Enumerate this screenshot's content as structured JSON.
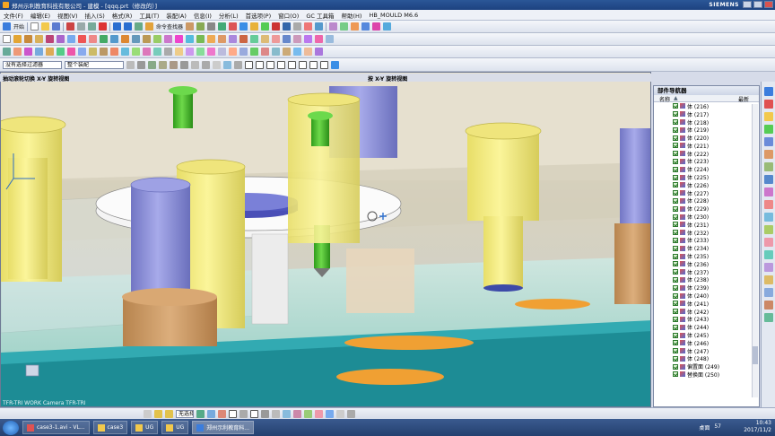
{
  "window": {
    "title": "郑州示利教育科技有限公司 - 建模 - [qqq.prt（修改的）]",
    "brand": "SIEMENS"
  },
  "menu": [
    "文件(F)",
    "编辑(E)",
    "视图(V)",
    "插入(S)",
    "格式(R)",
    "工具(T)",
    "装配(A)",
    "信息(I)",
    "分析(L)",
    "首选项(P)",
    "窗口(O)",
    "GC 工具箱",
    "帮助(H)",
    "HB_MOULD M6.6"
  ],
  "toolbar": {
    "start_label": "开始",
    "command_finder": "命令查找器",
    "filter_combo": "没有选择过滤器",
    "assembly_combo": "整个装配"
  },
  "viewport": {
    "left_label": "抽动滚轮切换 X-Y 旋转视图",
    "right_label": "按 X-Y 旋转视图",
    "wcs_label": "TFR-TRI WORK Camera TFR-TRI"
  },
  "navigator": {
    "title": "部件导航器",
    "col_name": "名称",
    "col_up": "最新",
    "items": [
      "体 (216)",
      "体 (217)",
      "体 (218)",
      "体 (219)",
      "体 (220)",
      "体 (221)",
      "体 (222)",
      "体 (223)",
      "体 (224)",
      "体 (225)",
      "体 (226)",
      "体 (227)",
      "体 (228)",
      "体 (229)",
      "体 (230)",
      "体 (231)",
      "体 (232)",
      "体 (233)",
      "体 (234)",
      "体 (235)",
      "体 (236)",
      "体 (237)",
      "体 (238)",
      "体 (239)",
      "体 (240)",
      "体 (241)",
      "体 (242)",
      "体 (243)",
      "体 (244)",
      "体 (245)",
      "体 (246)",
      "体 (247)",
      "体 (248)",
      "偏置面 (249)",
      "替换面 (250)"
    ]
  },
  "bottom_toolbar": {
    "label": "无选择过滤器"
  },
  "taskbar": {
    "buttons": [
      "case3-1.avi - VL...",
      "case3",
      "UG",
      "UG",
      "郑州示利教育科..."
    ],
    "tray_desktop": "桌面",
    "tray_num": "57",
    "time": "10:43",
    "date": "2017/11/2"
  },
  "colors": {
    "bottom_block": "#1d8c95",
    "plate": "#b9ddd5",
    "post_yellow": "#f5ee8c",
    "post_purple": "#8f92d6",
    "post_wood": "#c99b6c",
    "bolt_green": "#4cbf2c",
    "island_orange": "#f0a033"
  }
}
